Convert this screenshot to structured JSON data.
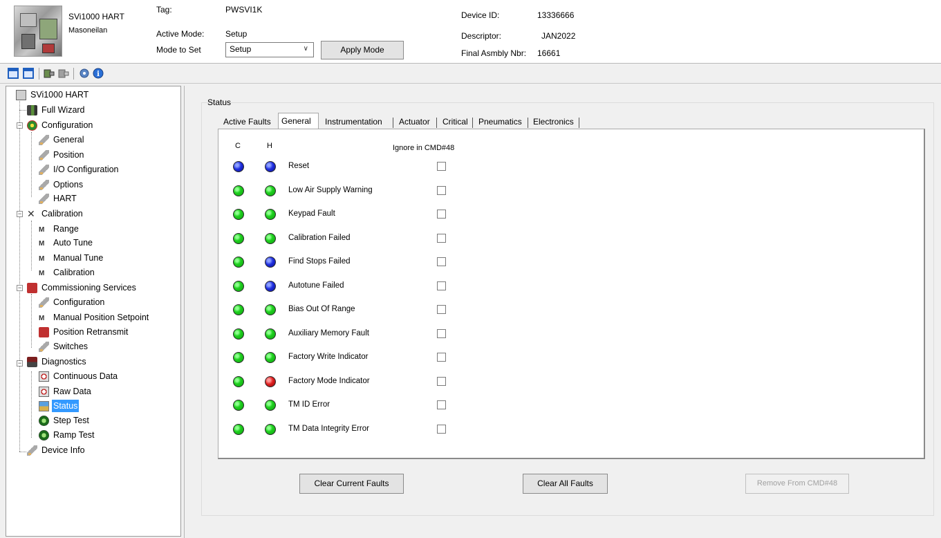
{
  "header": {
    "device_name": "SVi1000 HART",
    "manufacturer": "Masoneilan",
    "tag_label": "Tag:",
    "tag_value": "PWSVI1K",
    "active_mode_label": "Active Mode:",
    "active_mode_value": "Setup",
    "mode_to_set_label": "Mode to Set",
    "mode_to_set_value": "Setup",
    "apply_mode_label": "Apply Mode",
    "device_id_label": "Device ID:",
    "device_id_value": "13336666",
    "descriptor_label": "Descriptor:",
    "descriptor_value": "JAN2022",
    "final_asmbly_label": "Final Asmbly Nbr:",
    "final_asmbly_value": "16661"
  },
  "toolbar": {
    "icons": [
      "window-icon",
      "window-icon",
      "device-connect-icon",
      "device-disconnect-icon",
      "settings-icon",
      "info-icon"
    ]
  },
  "tree": {
    "root": "SVi1000 HART",
    "items": [
      {
        "label": "Full Wizard"
      },
      {
        "label": "Configuration"
      },
      {
        "label": "General"
      },
      {
        "label": "Position"
      },
      {
        "label": "I/O Configuration"
      },
      {
        "label": "Options"
      },
      {
        "label": "HART"
      },
      {
        "label": "Calibration"
      },
      {
        "label": "Range"
      },
      {
        "label": "Auto Tune"
      },
      {
        "label": "Manual Tune"
      },
      {
        "label": "Calibration"
      },
      {
        "label": "Commissioning Services"
      },
      {
        "label": "Configuration"
      },
      {
        "label": "Manual Position Setpoint"
      },
      {
        "label": "Position Retransmit"
      },
      {
        "label": "Switches"
      },
      {
        "label": "Diagnostics"
      },
      {
        "label": "Continuous Data"
      },
      {
        "label": "Raw Data"
      },
      {
        "label": "Status"
      },
      {
        "label": "Step Test"
      },
      {
        "label": "Ramp Test"
      },
      {
        "label": "Device Info"
      }
    ],
    "selected": "Status"
  },
  "status": {
    "group_label": "Status",
    "tabs": [
      {
        "label": "Active Faults"
      },
      {
        "label": "General"
      },
      {
        "label": "Instrumentation"
      },
      {
        "label": "Actuator"
      },
      {
        "label": "Critical"
      },
      {
        "label": "Pneumatics"
      },
      {
        "label": "Electronics"
      }
    ],
    "active_tab": "General",
    "col_c": "C",
    "col_h": "H",
    "col_ignore": "Ignore in CMD#48",
    "faults": [
      {
        "label": "Reset",
        "c": "blue",
        "h": "blue",
        "ignored": false
      },
      {
        "label": "Low Air Supply Warning",
        "c": "green",
        "h": "green",
        "ignored": false
      },
      {
        "label": "Keypad Fault",
        "c": "green",
        "h": "green",
        "ignored": false
      },
      {
        "label": "Calibration Failed",
        "c": "green",
        "h": "green",
        "ignored": false
      },
      {
        "label": "Find Stops Failed",
        "c": "green",
        "h": "blue",
        "ignored": false
      },
      {
        "label": "Autotune Failed",
        "c": "green",
        "h": "blue",
        "ignored": false
      },
      {
        "label": "Bias Out Of Range",
        "c": "green",
        "h": "green",
        "ignored": false
      },
      {
        "label": "Auxiliary Memory Fault",
        "c": "green",
        "h": "green",
        "ignored": false
      },
      {
        "label": "Factory Write Indicator",
        "c": "green",
        "h": "green",
        "ignored": false
      },
      {
        "label": "Factory Mode Indicator",
        "c": "green",
        "h": "red",
        "ignored": false
      },
      {
        "label": "TM ID Error",
        "c": "green",
        "h": "green",
        "ignored": false
      },
      {
        "label": "TM Data Integrity Error",
        "c": "green",
        "h": "green",
        "ignored": false
      }
    ],
    "buttons": {
      "clear_current": "Clear Current Faults",
      "clear_all": "Clear All Faults",
      "remove_cmd48": "Remove From CMD#48"
    }
  },
  "colors": {
    "led_green": "#1fd11f",
    "led_blue": "#1f2fe0",
    "led_red": "#e01f1f",
    "selection": "#3399ff"
  }
}
